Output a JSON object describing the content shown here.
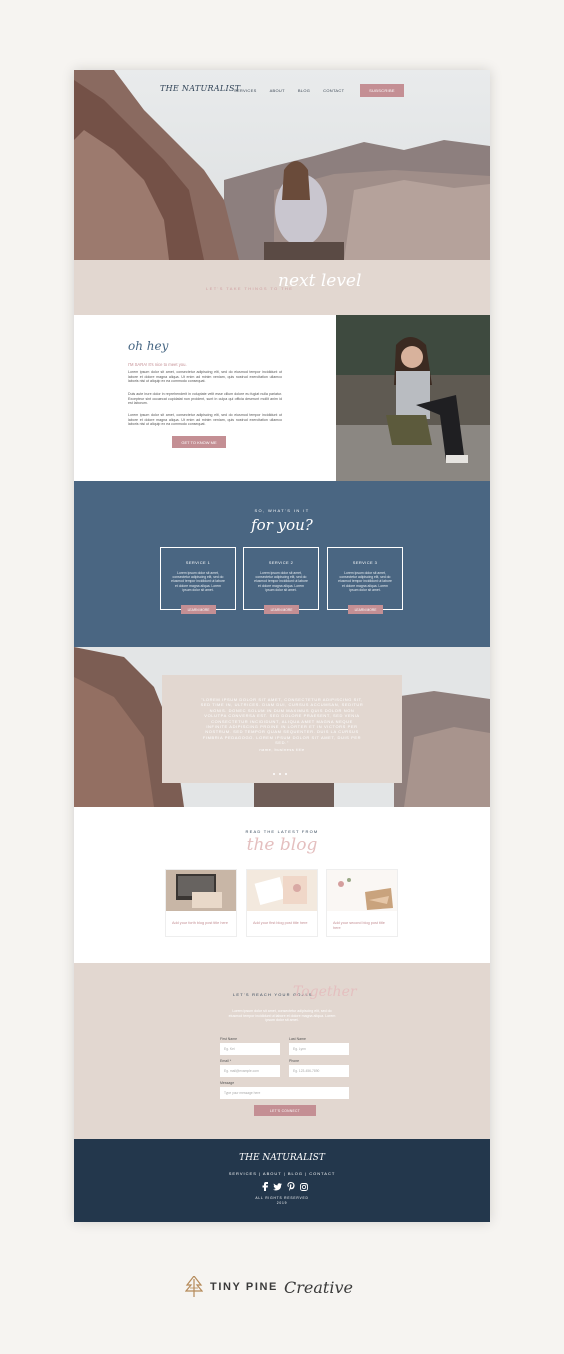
{
  "nav": {
    "logo": "THE NATURALIST",
    "links": [
      "SERVICES",
      "ABOUT",
      "BLOG",
      "CONTACT"
    ],
    "subscribe": "SUBSCRIBE"
  },
  "tagline": {
    "lead": "LET'S TAKE THINGS TO THE",
    "script": "next level"
  },
  "about": {
    "greeting": "oh hey",
    "intro": "I'M SARA! It's nice to meet you.",
    "paragraphs": [
      "Lorem ipsum dolor sit amet, consectetur adipiscing elit, sed do eiusmod tempor incididunt ut labore et dolore magna aliqua. Ut enim ad minim veniam, quis nostrud exercitation ullamco laboris nisi ut aliquip ex ea commodo consequat.",
      "Duis aute irure dolor in reprehenderit in voluptate velit esse cillum dolore eu fugiat nulla pariatur. Excepteur sint occaecat cupidatat non proident, sunt in culpa qui officia deserunt mollit anim id est laborum.",
      "Lorem ipsum dolor sit amet, consectetur adipiscing elit, sed do eiusmod tempor incididunt ut labore et dolore magna aliqua. Ut enim ad minim veniam, quis nostrud exercitation ullamco laboris nisi ut aliquip ex ea commodo consequat."
    ],
    "button": "GET TO KNOW ME"
  },
  "services": {
    "lead": "SO, WHAT'S IN IT",
    "script": "for you?",
    "cards": [
      {
        "title": "SERVICE 1",
        "body": "Lorem ipsum dolor sit amet, consectetur adipiscing elit, sed do eiusmod tempor incididunt ut labore et dolore magna aliqua. Lorem ipsum dolor sit amet.",
        "button": "LEARN MORE"
      },
      {
        "title": "SERVICE 2",
        "body": "Lorem ipsum dolor sit amet, consectetur adipiscing elit, sed do eiusmod tempor incididunt ut labore et dolore magna aliqua. Lorem ipsum dolor sit amet.",
        "button": "LEARN MORE"
      },
      {
        "title": "SERVICE 3",
        "body": "Lorem ipsum dolor sit amet, consectetur adipiscing elit, sed do eiusmod tempor incididunt ut labore et dolore magna aliqua. Lorem ipsum dolor sit amet.",
        "button": "LEARN MORE"
      }
    ]
  },
  "testimonial": {
    "quote": "\"LOREM IPSUM DOLOR SIT AMET, CONSECTETUR ADIPISCING SIT, SED TIME IN, ULTRICES. DIAM DUI, CURSUS ACCUMSAN, SEDITUR NONIS. DONEC SOLUM IN DUM MAXIMUS QUIS DOLOR NON VOLUTPA CONVERSA EST. SED DOLORE PRAESENT, SED VENIA CONSECTETUR INCIDIDUNT, ALIQUA AMET MAGNA NEQUE INFINITE ADIPISCING PROINE IN LORTER ET IN VICTORS PER NOSTRUM. SED TEMPOR QUAM SEQUENTER. DUIS LA CURSUS FIMBRIA PEDAGOGO. LOREM IPSUM DOLOR SIT AMET, DUIS PER SED.\"",
    "name": "name, business title"
  },
  "blog": {
    "lead": "READ THE LATEST FROM",
    "script": "the blog",
    "posts": [
      {
        "title": "Add your forth blog post title here"
      },
      {
        "title": "Add your first blog post title here"
      },
      {
        "title": "Add your second blog post title here"
      }
    ]
  },
  "contact": {
    "lead": "LET'S REACH YOUR GOALS",
    "script": "Together",
    "intro": "Lorem ipsum dolor sit amet, consectetur adipiscing elit, sed do eiusmod tempor incididunt ut labore et dolore magna aliqua. Lorem ipsum dolor sit amet.",
    "fields": {
      "first_name": {
        "label": "First Name",
        "placeholder": "Eg. Kei"
      },
      "last_name": {
        "label": "Last Name",
        "placeholder": "Eg. Lynn"
      },
      "email": {
        "label": "Email *",
        "placeholder": "Eg. mail@example.com"
      },
      "phone": {
        "label": "Phone",
        "placeholder": "Eg. 123-456-7890"
      },
      "message": {
        "label": "Message",
        "placeholder": "Type your message here"
      }
    },
    "button": "LET'S CONNECT"
  },
  "footer": {
    "logo": "THE NATURALIST",
    "nav": "SERVICES | ABOUT | BLOG | CONTACT",
    "social": [
      "facebook-icon",
      "twitter-icon",
      "pinterest-icon",
      "instagram-icon"
    ],
    "rights": "ALL RIGHTS RESERVED",
    "year": "2019"
  },
  "brand": {
    "name": "TINY PINE",
    "script": "Creative"
  },
  "colors": {
    "accent_pink": "#c48f94",
    "slate_blue": "#4a6682",
    "navy": "#23374c",
    "beige": "#e2d7d0"
  }
}
